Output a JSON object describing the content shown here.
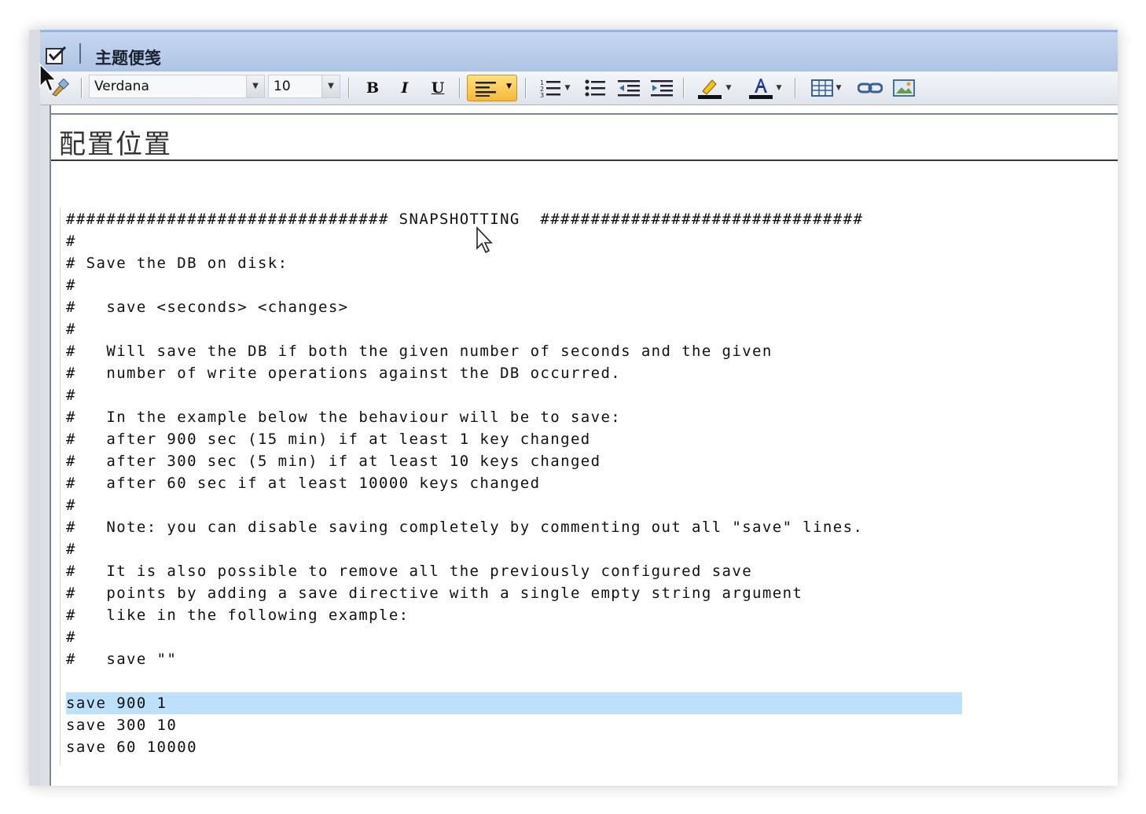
{
  "window": {
    "title": "主题便笺"
  },
  "toolbar": {
    "font_name": "Verdana",
    "font_size": "10",
    "bold_label": "B",
    "italic_label": "I",
    "underline_label": "U",
    "highlight_color": "#f2c41b",
    "font_color": "#1b3a9b"
  },
  "editor": {
    "heading": "配置位置",
    "lines": [
      "################################ SNAPSHOTTING  ################################",
      "#",
      "# Save the DB on disk:",
      "#",
      "#   save <seconds> <changes>",
      "#",
      "#   Will save the DB if both the given number of seconds and the given",
      "#   number of write operations against the DB occurred.",
      "#",
      "#   In the example below the behaviour will be to save:",
      "#   after 900 sec (15 min) if at least 1 key changed",
      "#   after 300 sec (5 min) if at least 10 keys changed",
      "#   after 60 sec if at least 10000 keys changed",
      "#",
      "#   Note: you can disable saving completely by commenting out all \"save\" lines.",
      "#",
      "#   It is also possible to remove all the previously configured save",
      "#   points by adding a save directive with a single empty string argument",
      "#   like in the following example:",
      "#",
      "#   save \"\"",
      "",
      "save 900 1",
      "save 300 10",
      "save 60 10000"
    ],
    "highlighted_line": 22
  }
}
